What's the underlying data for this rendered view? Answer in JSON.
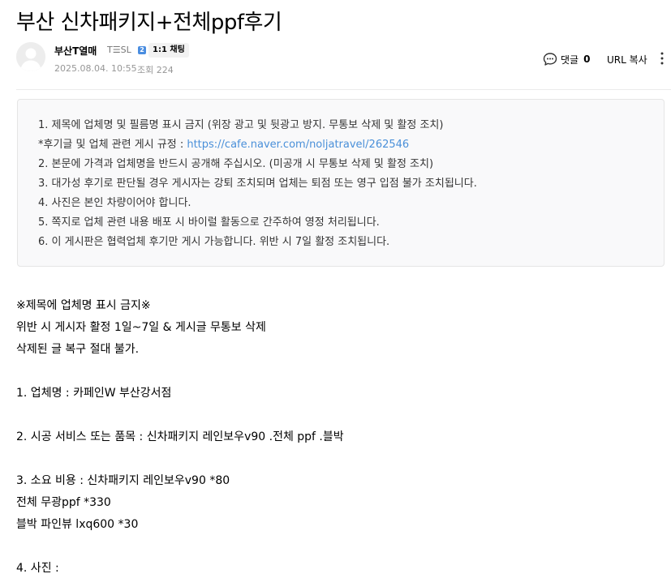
{
  "post": {
    "title": "부산 신차패키지+전체ppf후기"
  },
  "author": {
    "nickname": "부산T열매",
    "grade": "T☰SL",
    "grade_badge": "2",
    "chat_label": "1:1 채팅",
    "date": "2025.08.04. 10:55",
    "views": "조회 224"
  },
  "actions": {
    "comment_label": "댓글",
    "comment_count": "0",
    "url_copy_label": "URL 복사"
  },
  "notice": {
    "line1": "1. 제목에 업체명 및 필름명 표시 금지 (위장 광고 및 뒷광고 방지. 무통보 삭제 및 활정 조치)",
    "line2_prefix": "*후기글 및 업체 관련 게시 규정 : ",
    "line2_link": "https://cafe.naver.com/noljatravel/262546",
    "line3": "2. 본문에 가격과 업체명을 반드시 공개해 주십시오. (미공개 시 무통보 삭제 및 활정 조치)",
    "line4": "3. 대가성 후기로 판단될 경우 게시자는 강퇴 조치되며 업체는 퇴점 또는 영구 입점 불가 조치됩니다.",
    "line5": "4. 사진은 본인 차량이어야 합니다.",
    "line6": "5. 쪽지로 업체 관련 내용 배포 시 바이럴 활동으로 간주하여 영정 처리됩니다.",
    "line7": "6. 이 게시판은 협력업체 후기만 게시 가능합니다. 위반 시 7일 활정 조치됩니다."
  },
  "body": {
    "lines": [
      "※제목에 업체명 표시 금지※",
      "위반 시 게시자 활정 1일~7일 & 게시글 무통보 삭제",
      "삭제된 글 복구 절대 불가.",
      "",
      "1. 업체명 :  카페인W 부산강서점",
      "",
      "2. 시공 서비스 또는 품목 :  신차패키지 레인보우v90 .전체 ppf .블박",
      "",
      "3. 소요 비용 :  신차패키지 레인보우v90 *80",
      "전체 무광ppf *330",
      "블박 파인뷰 lxq600 *30",
      "",
      "4. 사진 :"
    ]
  },
  "icons": {
    "avatar": "default-profile-icon",
    "comment": "speech-bubble-icon",
    "more": "vertical-dots-icon"
  },
  "colors": {
    "link": "#4a90d9",
    "notice_bg": "#f9f9fa",
    "meta_gray": "#979797"
  }
}
